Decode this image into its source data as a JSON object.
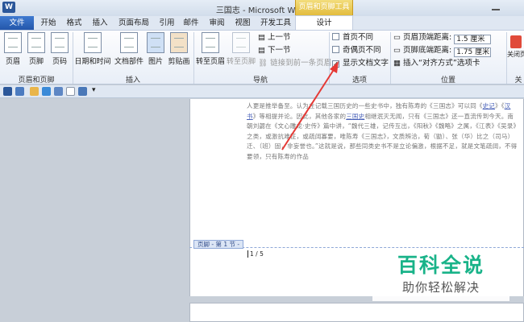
{
  "window": {
    "title": "三国志 - Microsoft Word",
    "app_icon": "W",
    "context_tab_group": "页眉和页脚工具"
  },
  "tabs": [
    {
      "label": "文件",
      "active": false
    },
    {
      "label": "开始"
    },
    {
      "label": "格式"
    },
    {
      "label": "插入"
    },
    {
      "label": "页面布局"
    },
    {
      "label": "引用"
    },
    {
      "label": "邮件"
    },
    {
      "label": "审阅"
    },
    {
      "label": "视图"
    },
    {
      "label": "开发工具"
    },
    {
      "label": "设计",
      "active": true
    }
  ],
  "ribbon": {
    "groups": [
      {
        "name": "页眉和页脚",
        "buttons": [
          "页眉",
          "页脚",
          "页码"
        ]
      },
      {
        "name": "插入",
        "buttons": [
          "日期和时间",
          "文档部件",
          "图片",
          "剪贴画"
        ]
      },
      {
        "name": "导航",
        "buttons": [
          "转至页眉",
          "转至页脚"
        ],
        "small": [
          "上一节",
          "下一节",
          "链接到前一条页眉"
        ]
      },
      {
        "name": "选项",
        "checkboxes": [
          {
            "label": "首页不同",
            "checked": false
          },
          {
            "label": "奇偶页不同",
            "checked": false
          },
          {
            "label": "显示文档文字",
            "checked": true
          }
        ]
      },
      {
        "name": "位置",
        "fields": [
          {
            "label": "页眉顶端距离:",
            "value": "1.5 厘米"
          },
          {
            "label": "页脚底端距离:",
            "value": "1.75 厘米"
          }
        ],
        "small": "插入“对齐方式”选项卡"
      },
      {
        "name": "关",
        "buttons": [
          "关闭页眉和"
        ]
      }
    ]
  },
  "document": {
    "body_segments": [
      {
        "t": "人更是推举备至。认为在记载三国历史的一些史书中，独有陈寿的《三国志》可以同《"
      },
      {
        "t": "史记",
        "link": true
      },
      {
        "t": "》《"
      },
      {
        "t": "汉书",
        "link": true
      },
      {
        "t": "》等相提并论。因此，其他各家的"
      },
      {
        "t": "三国史",
        "link": true
      },
      {
        "t": "相继泯灭无闻，只有《三国志》还一直流传到今天。南朝刘勰在《文心雕龙·史传》篇中讲，“魏代三雄，记传互出，《阳秋》《魏略》之属，《江表》《吴录》之类，或激抗难征，或疏阔寡要，唯陈寿《三国志》，文质辨洽，荀（勖）、张（华）比之（司马）迁、（班）固，非妄誉也。”这就是说，那些同类史书不是立论偏激，根据不足，就是文笔疏阔，不得要领，只有陈寿的作品"
      }
    ],
    "footer_tag": "页脚 - 第 1 节 -",
    "page_number": "1 / 5"
  },
  "watermark": {
    "line1": "百科全说",
    "line2": "助你轻松解决"
  },
  "accent": {
    "file_tab": "#2b5fb4",
    "context": "#e2bb3a",
    "watermark": "#19b389",
    "arrow": "#e53935"
  }
}
